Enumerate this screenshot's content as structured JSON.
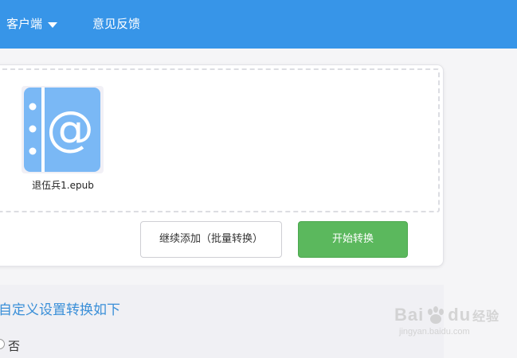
{
  "nav": {
    "client_label": "客户端",
    "feedback_label": "意见反馈"
  },
  "upload": {
    "file": {
      "name": "退伍兵1.epub",
      "icon": "epub-at-icon"
    },
    "add_more_label": "继续添加（批量转换）",
    "start_label": "开始转换"
  },
  "settings": {
    "title": "自定义设置转换如下",
    "option_label": "否"
  },
  "watermark": {
    "brand": "Bai",
    "brand2": "du",
    "brand_cn": "经验",
    "url": "jingyan.baidu.com"
  },
  "colors": {
    "topbar": "#3795e8",
    "start_button": "#5bb85d",
    "title_text": "#3a8fd8",
    "file_icon": "#7ab8f5"
  }
}
